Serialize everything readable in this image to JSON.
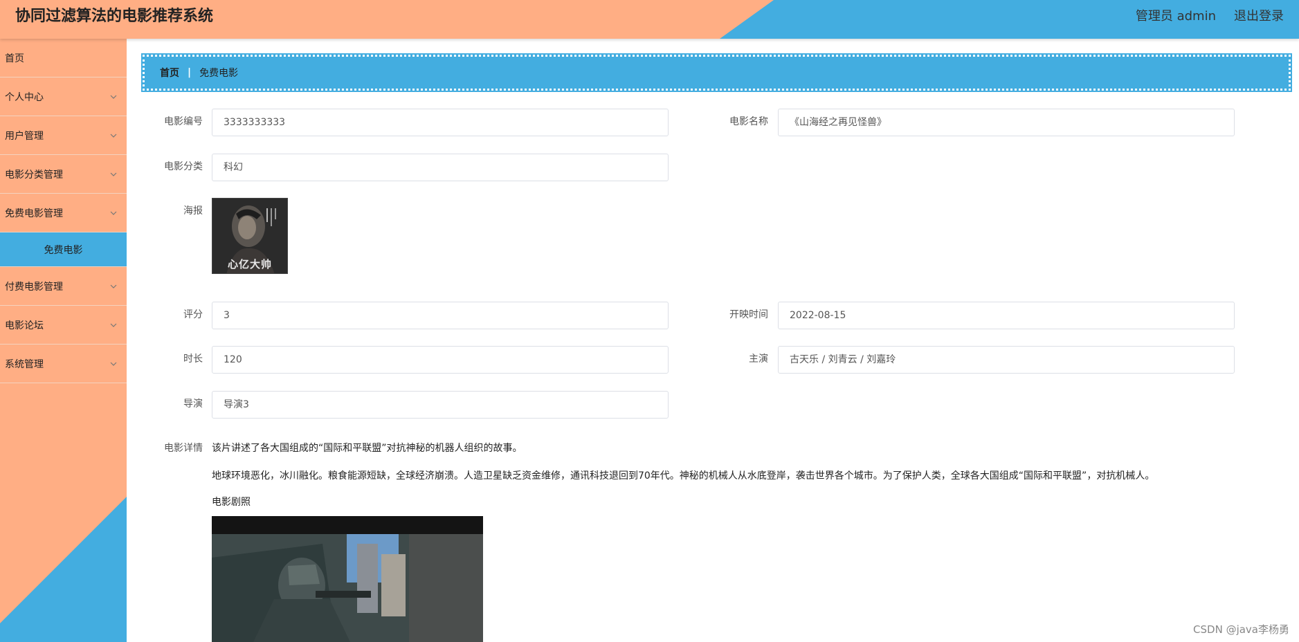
{
  "header": {
    "title": "协同过滤算法的电影推荐系统",
    "user_label": "管理员 admin",
    "logout_label": "退出登录",
    "colors": {
      "orange": "#ffae84",
      "blue": "#43ade0"
    }
  },
  "sidebar": {
    "items": [
      {
        "label": "首页",
        "has_chevron": false
      },
      {
        "label": "个人中心",
        "has_chevron": true
      },
      {
        "label": "用户管理",
        "has_chevron": true
      },
      {
        "label": "电影分类管理",
        "has_chevron": true
      },
      {
        "label": "免费电影管理",
        "has_chevron": true
      },
      {
        "label": "付费电影管理",
        "has_chevron": true
      },
      {
        "label": "电影论坛",
        "has_chevron": true
      },
      {
        "label": "系统管理",
        "has_chevron": true
      }
    ],
    "active_sub_item": "免费电影"
  },
  "breadcrumb": {
    "home": "首页",
    "separator": "|",
    "current": "免费电影"
  },
  "form": {
    "movie_no_label": "电影编号",
    "movie_no_value": "3333333333",
    "movie_name_label": "电影名称",
    "movie_name_value": "《山海经之再见怪兽》",
    "category_label": "电影分类",
    "category_value": "科幻",
    "poster_label": "海报",
    "poster_caption": "心亿大帅",
    "rating_label": "评分",
    "rating_value": "3",
    "release_label": "开映时间",
    "release_value": "2022-08-15",
    "duration_label": "时长",
    "duration_value": "120",
    "cast_label": "主演",
    "cast_value": "古天乐 / 刘青云 / 刘嘉玲",
    "director_label": "导演",
    "director_value": "导演3",
    "detail_label": "电影详情",
    "detail_line1": "该片讲述了各大国组成的“国际和平联盟”对抗神秘的机器人组织的故事。",
    "detail_line2": "地球环境恶化，冰川融化。粮食能源短缺，全球经济崩溃。人造卫星缺乏资金维修，通讯科技退回到70年代。神秘的机械人从水底登岸，袭击世界各个城市。为了保护人类，全球各大国组成“国际和平联盟”，对抗机械人。",
    "stills_label": "电影剧照"
  },
  "watermark": "CSDN @java李杨勇"
}
